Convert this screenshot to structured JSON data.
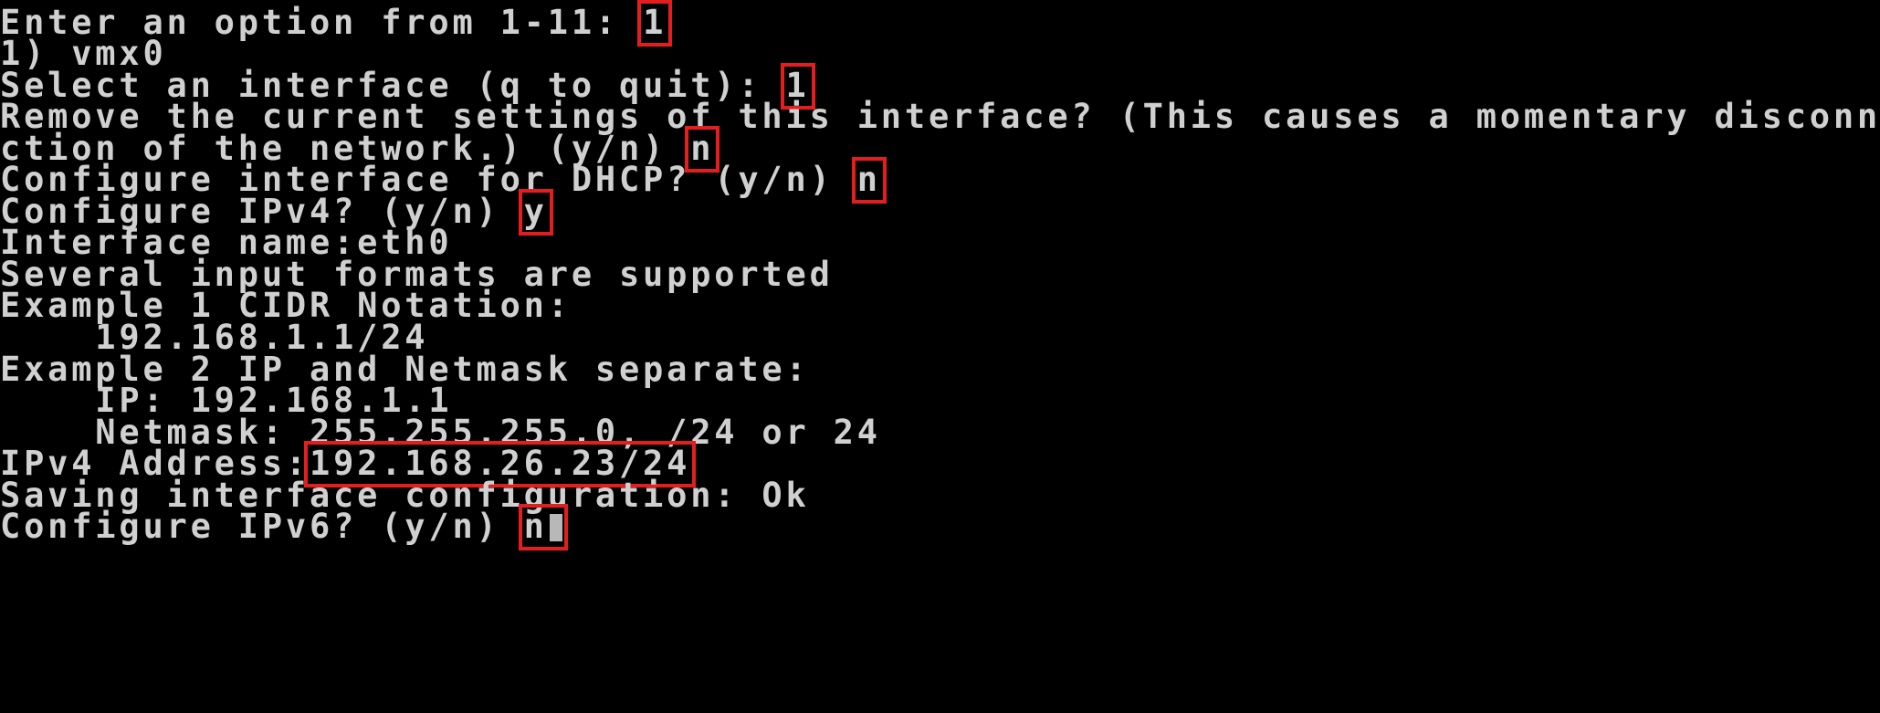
{
  "terminal": {
    "highlight_color": "#e41e1e",
    "text_color": "#d0d0d0",
    "background": "#000000",
    "lines": [
      {
        "prompt": "Enter an option from 1-11: ",
        "input": "1"
      },
      {
        "text": "1) vmx0"
      },
      {
        "prompt": "Select an interface (q to quit): ",
        "input": "1"
      },
      {
        "text": "Remove the current settings of this interface? (This causes a momentary disconne"
      },
      {
        "prompt": "ction of the network.) (y/n) ",
        "input": "n"
      },
      {
        "prompt": "Configure interface for DHCP? (y/n) ",
        "input": "n"
      },
      {
        "prompt": "Configure IPv4? (y/n) ",
        "input": "y"
      },
      {
        "text": "Interface name:eth0"
      },
      {
        "text": "Several input formats are supported"
      },
      {
        "text": "Example 1 CIDR Notation:"
      },
      {
        "text": "    192.168.1.1/24"
      },
      {
        "text": "Example 2 IP and Netmask separate:"
      },
      {
        "text": "    IP: 192.168.1.1"
      },
      {
        "text": "    Netmask: 255.255.255.0, /24 or 24"
      },
      {
        "prompt": "IPv4 Address:",
        "input": "192.168.26.23/24"
      },
      {
        "text": "Saving interface configuration: Ok"
      },
      {
        "prompt": "Configure IPv6? (y/n) ",
        "input": "n"
      }
    ]
  }
}
